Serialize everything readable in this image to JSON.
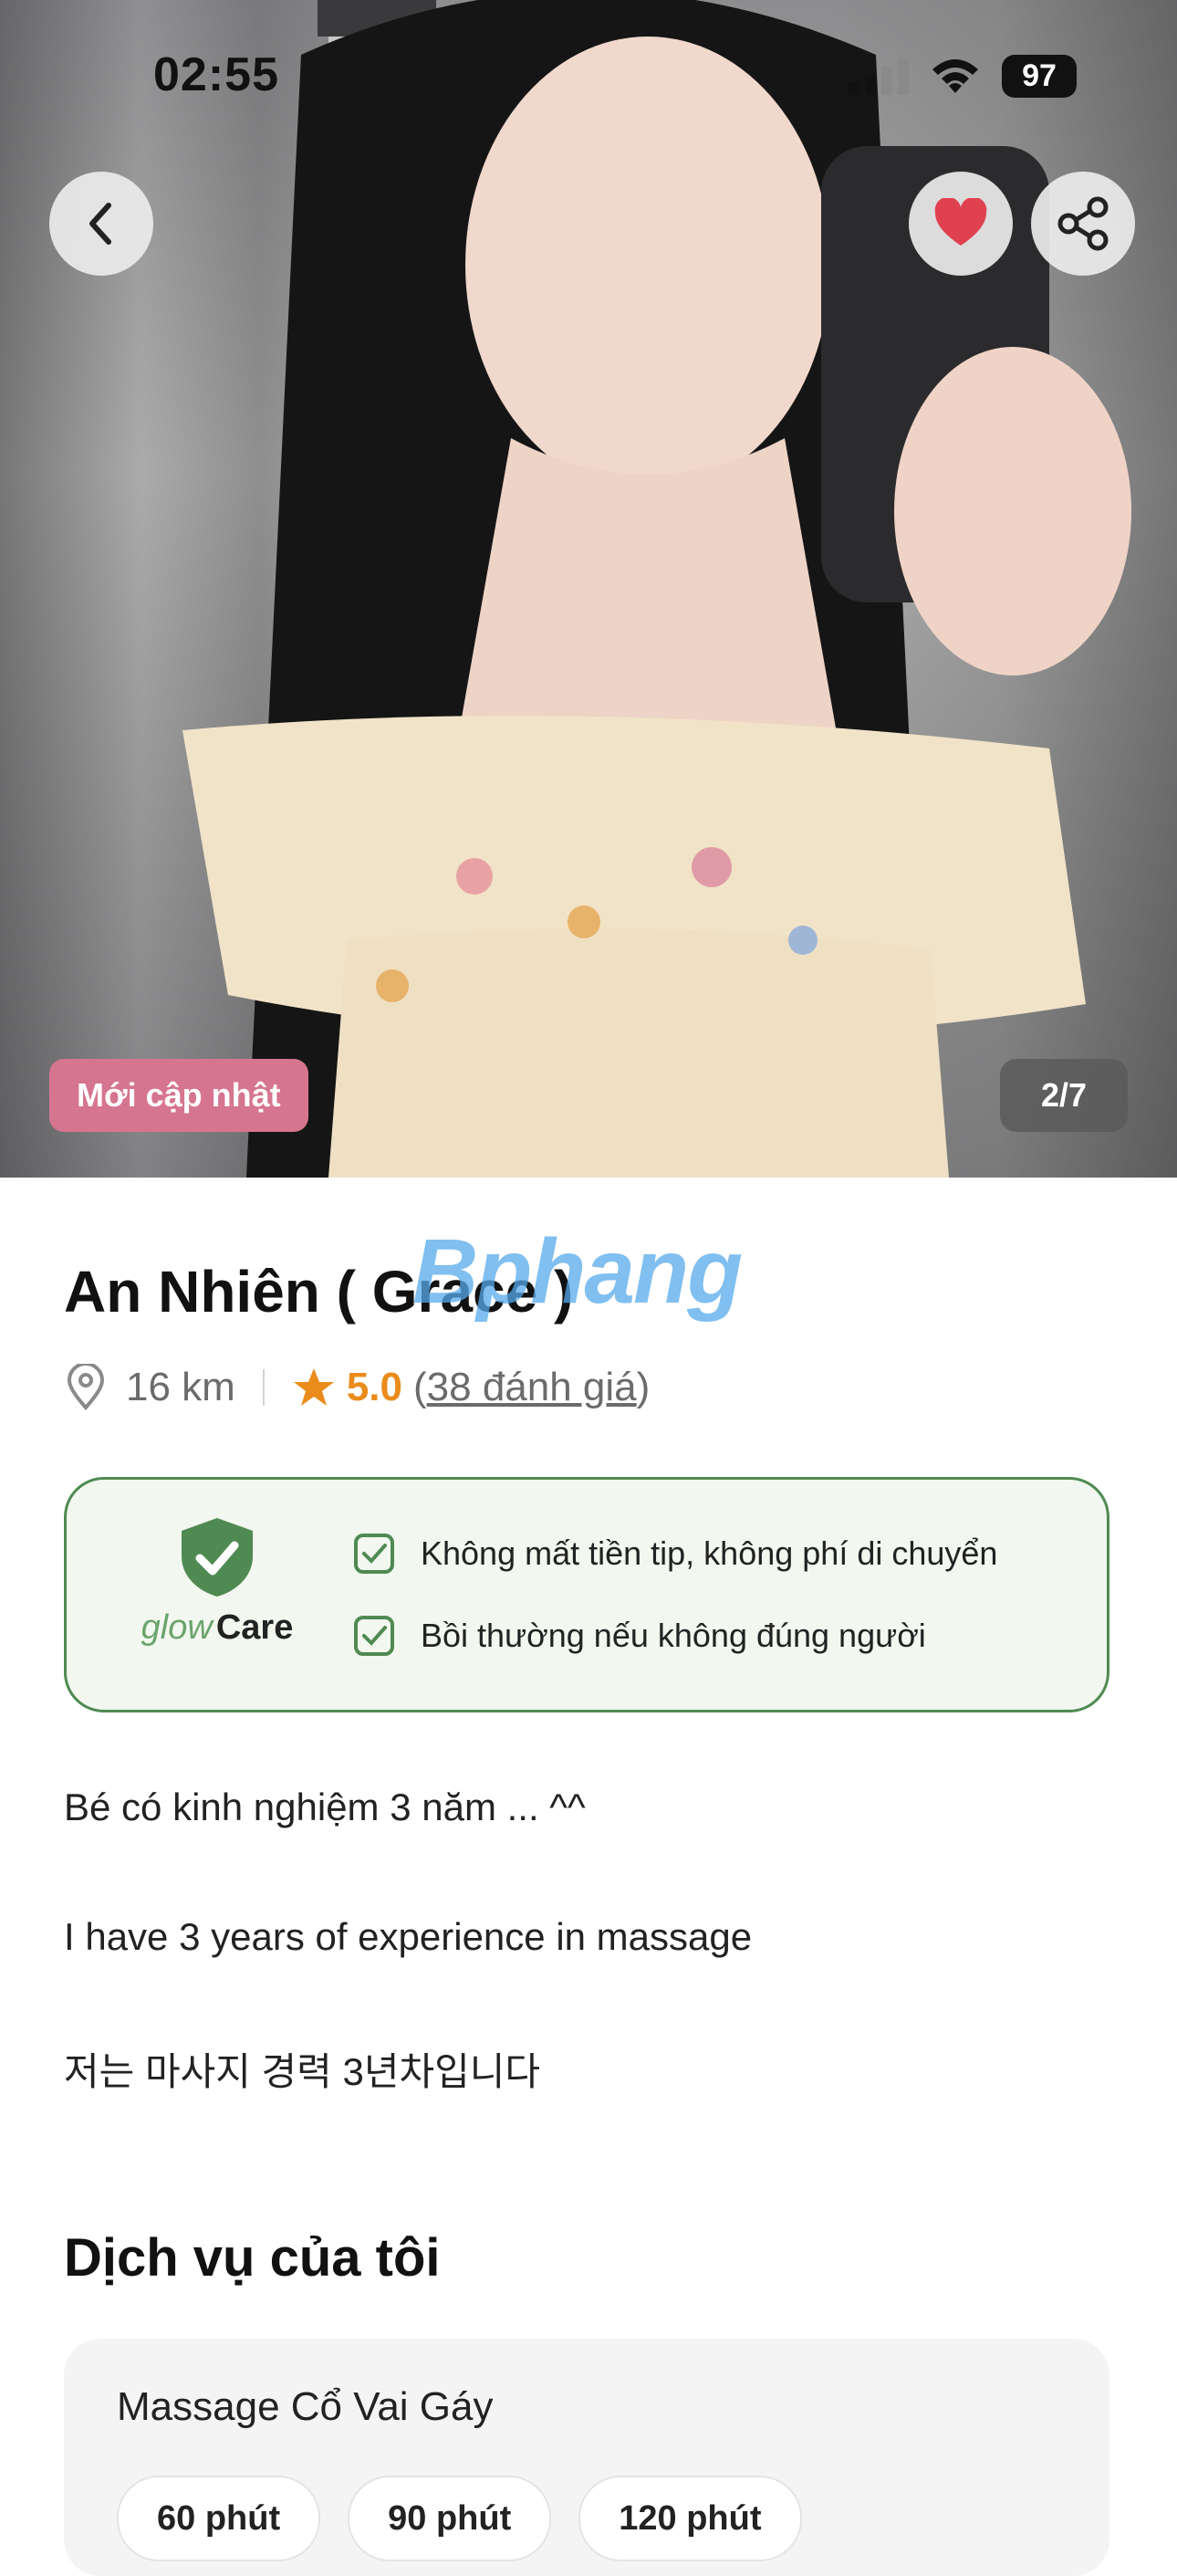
{
  "status_bar": {
    "time": "02:55",
    "battery": "97"
  },
  "gallery": {
    "badge": "Mới cập nhật",
    "counter": "2/7"
  },
  "profile": {
    "name": "An Nhiên ( Grace )",
    "distance": "16 km",
    "rating": "5.0",
    "reviews": "38 đánh giá",
    "watermark": "Bphang"
  },
  "care": {
    "brand_glow": "glow",
    "brand_care": "Care",
    "items": [
      "Không mất tiền tip, không phí di chuyển",
      "Bồi thường nếu không đúng người"
    ]
  },
  "description": [
    "Bé có kinh nghiệm 3 năm ... ^^",
    "I have 3 years of experience in massage",
    "저는 마사지 경력 3년차입니다"
  ],
  "services": {
    "title": "Dịch vụ của tôi",
    "items": [
      {
        "name": "Massage Cổ Vai Gáy",
        "durations": [
          "60 phút",
          "90 phút",
          "120 phút"
        ]
      }
    ]
  },
  "icons": [
    "chevron-left-icon",
    "heart-icon",
    "share-icon",
    "location-pin-icon",
    "star-icon",
    "shield-check-icon",
    "checkbox-icon",
    "signal-icon",
    "wifi-icon"
  ],
  "colors": {
    "accent_rating": "#ea8c1c",
    "care_green": "#4f8a52",
    "badge_pink": "#d6758f"
  }
}
